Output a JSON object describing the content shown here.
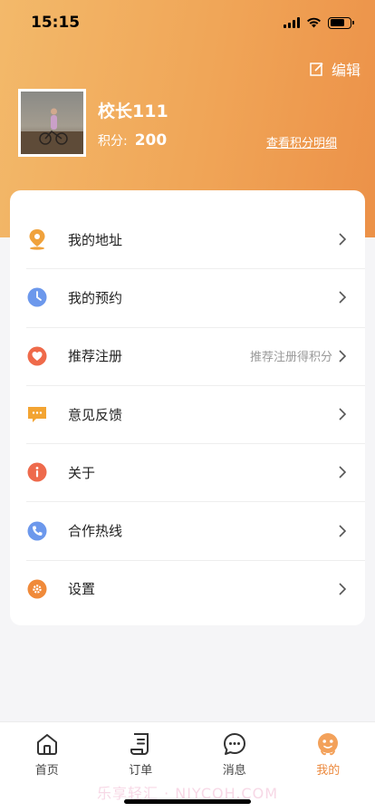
{
  "status_bar": {
    "time": "15:15"
  },
  "header": {
    "edit_label": "编辑",
    "user_name": "校长111",
    "points_label": "积分:",
    "points_value": "200",
    "points_detail_link": "查看积分明细"
  },
  "menu": {
    "items": [
      {
        "label": "我的地址",
        "icon": "location-pin-icon",
        "hint": ""
      },
      {
        "label": "我的预约",
        "icon": "clock-icon",
        "hint": ""
      },
      {
        "label": "推荐注册",
        "icon": "heart-icon",
        "hint": "推荐注册得积分"
      },
      {
        "label": "意见反馈",
        "icon": "chat-bubble-icon",
        "hint": ""
      },
      {
        "label": "关于",
        "icon": "info-icon",
        "hint": ""
      },
      {
        "label": "合作热线",
        "icon": "phone-icon",
        "hint": ""
      },
      {
        "label": "设置",
        "icon": "gear-icon",
        "hint": ""
      }
    ]
  },
  "tabbar": {
    "tabs": [
      {
        "label": "首页",
        "icon": "home-icon"
      },
      {
        "label": "订单",
        "icon": "order-icon"
      },
      {
        "label": "消息",
        "icon": "message-icon"
      },
      {
        "label": "我的",
        "icon": "profile-icon",
        "active": true
      }
    ]
  },
  "watermark": "乐享轻汇 · NIYCOH.COM",
  "colors": {
    "header_gradient_start": "#f3b96a",
    "header_gradient_end": "#ec9148",
    "accent": "#ec8a3f",
    "location_icon": "#f0a23c",
    "clock_icon": "#6c98ec",
    "heart_icon": "#ef6a4a",
    "chat_icon": "#f3a432",
    "info_icon": "#ee6a4c",
    "phone_icon": "#6c98ec",
    "gear_icon": "#f08a3a"
  }
}
